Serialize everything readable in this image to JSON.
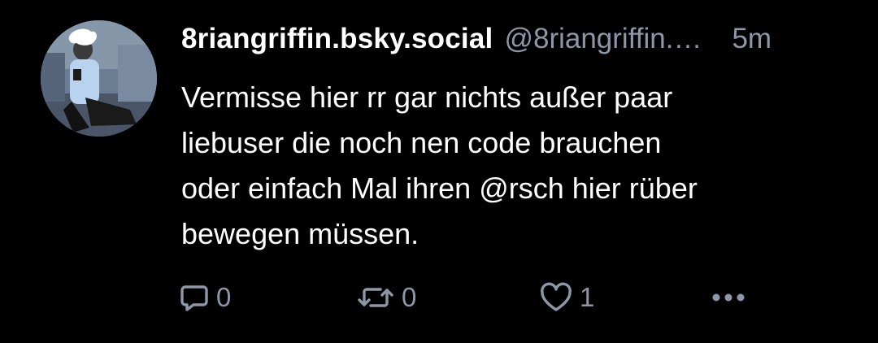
{
  "post": {
    "author": {
      "display_name": "8riangriffin.bsky.social",
      "handle": "@8riangriffin.bsky.social",
      "avatar_label": "user-avatar"
    },
    "time_ago": "5m",
    "text": "Vermisse hier rr gar nichts außer paar\nliebuser die noch nen code brauchen\noder einfach Mal ihren @rsch hier rüber\nbewegen müssen.",
    "actions": {
      "reply": {
        "icon": "comment-icon",
        "count": "0"
      },
      "repost": {
        "icon": "repost-icon",
        "count": "0"
      },
      "like": {
        "icon": "heart-icon",
        "count": "1"
      },
      "more": {
        "icon": "more-dots-icon"
      }
    }
  },
  "colors": {
    "background": "#000000",
    "text_primary": "#ffffff",
    "text_secondary": "#8d97a8"
  }
}
